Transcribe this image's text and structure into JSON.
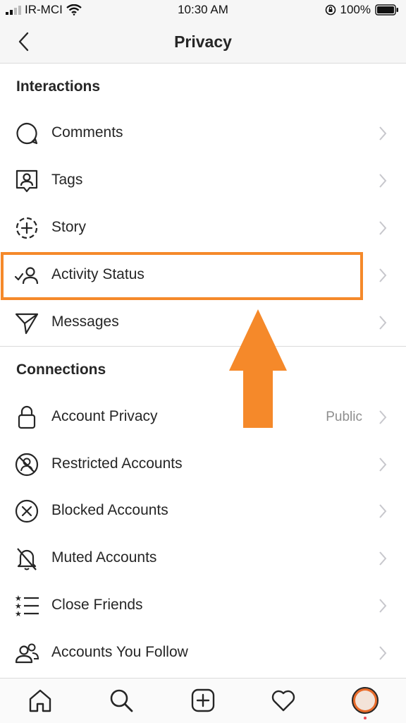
{
  "status_bar": {
    "carrier": "IR-MCI",
    "time": "10:30 AM",
    "battery": "100%"
  },
  "header": {
    "title": "Privacy",
    "back_icon": "chevron-left-icon"
  },
  "sections": {
    "interactions": {
      "title": "Interactions",
      "items": [
        {
          "label": "Comments",
          "icon": "comment-bubble-icon"
        },
        {
          "label": "Tags",
          "icon": "tag-person-icon"
        },
        {
          "label": "Story",
          "icon": "story-plus-icon"
        },
        {
          "label": "Activity Status",
          "icon": "activity-status-icon"
        },
        {
          "label": "Messages",
          "icon": "paper-plane-icon"
        }
      ]
    },
    "connections": {
      "title": "Connections",
      "items": [
        {
          "label": "Account Privacy",
          "value": "Public",
          "icon": "lock-icon"
        },
        {
          "label": "Restricted Accounts",
          "icon": "restricted-icon"
        },
        {
          "label": "Blocked Accounts",
          "icon": "blocked-icon"
        },
        {
          "label": "Muted Accounts",
          "icon": "muted-bell-icon"
        },
        {
          "label": "Close Friends",
          "icon": "star-list-icon"
        },
        {
          "label": "Accounts You Follow",
          "icon": "people-icon"
        }
      ]
    }
  },
  "annotation": {
    "highlight_color": "#f5892a",
    "highlighted_item": "Activity Status"
  },
  "tab_bar": {
    "tabs": [
      "home-icon",
      "search-icon",
      "new-post-icon",
      "heart-icon",
      "profile-avatar"
    ]
  },
  "colors": {
    "text": "#262626",
    "secondary": "#8e8e8e",
    "divider": "#dbdbdb",
    "accent": "#f5892a"
  }
}
